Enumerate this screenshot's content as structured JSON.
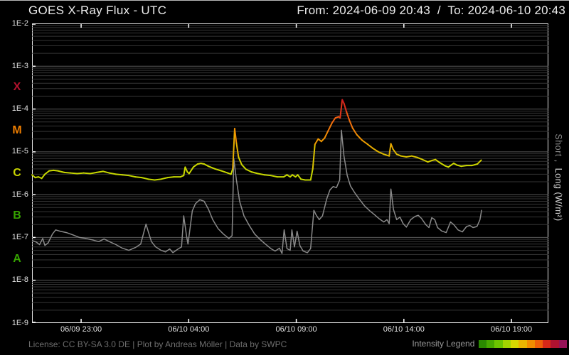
{
  "header": {
    "title": "GOES X-Ray Flux - UTC",
    "range": "From: 2024-06-09 20:43  /  To: 2024-06-10 20:43"
  },
  "footer": {
    "license": "License: CC BY-SA 3.0 DE | Plot by Andreas Möller | Data by SWPC",
    "legend_label": "Intensity Legend "
  },
  "right_axis_label": {
    "short": "Short",
    "separator": " ,  ",
    "long": "Long (W/m²)"
  },
  "chart_data": {
    "type": "line",
    "title": "GOES X-Ray Flux - UTC",
    "time_start": "2024-06-09 20:43",
    "time_end": "2024-06-10 20:43",
    "y_scale": "log",
    "y_range_labels": [
      "1E-9",
      "1E-2"
    ],
    "y_unit": "W/m²",
    "grid": true,
    "x_axis": {
      "ticks": [
        {
          "label": "06/09 23:00",
          "hours_from_start": 2.2833
        },
        {
          "label": "06/10 04:00",
          "hours_from_start": 7.2833
        },
        {
          "label": "06/10 09:00",
          "hours_from_start": 12.2833
        },
        {
          "label": "06/10 14:00",
          "hours_from_start": 17.2833
        },
        {
          "label": "06/10 19:00",
          "hours_from_start": 22.2833
        }
      ]
    },
    "y_axis": {
      "labels": [
        {
          "label": "1E-2",
          "exp": -2
        },
        {
          "label": "1E-3",
          "exp": -3
        },
        {
          "label": "1E-4",
          "exp": -4
        },
        {
          "label": "1E-5",
          "exp": -5
        },
        {
          "label": "1E-6",
          "exp": -6
        },
        {
          "label": "1E-7",
          "exp": -7
        },
        {
          "label": "1E-8",
          "exp": -8
        },
        {
          "label": "1E-9",
          "exp": -9
        }
      ]
    },
    "flare_classes": [
      {
        "label": "X",
        "mid_exp": -3.5,
        "color": "#b5122e"
      },
      {
        "label": "M",
        "mid_exp": -4.5,
        "color": "#ee7e00"
      },
      {
        "label": "C",
        "mid_exp": -5.5,
        "color": "#c9d500"
      },
      {
        "label": "B",
        "mid_exp": -6.5,
        "color": "#36a400"
      },
      {
        "label": "A",
        "mid_exp": -7.5,
        "color": "#36a400"
      }
    ],
    "legend_swatches": [
      "#2a8a00",
      "#46a800",
      "#6cc400",
      "#a2d400",
      "#d6d800",
      "#e9b400",
      "#f08c00",
      "#ee5e08",
      "#d82818",
      "#b01230",
      "#951257"
    ],
    "intensity_scale_stops": [
      {
        "logv": -7.0,
        "color": [
          74,
          158,
          0
        ]
      },
      {
        "logv": -6.3,
        "color": [
          140,
          200,
          0
        ]
      },
      {
        "logv": -5.9,
        "color": [
          188,
          212,
          0
        ]
      },
      {
        "logv": -5.3,
        "color": [
          204,
          216,
          0
        ]
      },
      {
        "logv": -5.0,
        "color": [
          226,
          182,
          0
        ]
      },
      {
        "logv": -4.75,
        "color": [
          238,
          152,
          0
        ]
      },
      {
        "logv": -4.45,
        "color": [
          242,
          125,
          10
        ]
      },
      {
        "logv": -4.15,
        "color": [
          236,
          85,
          16
        ]
      },
      {
        "logv": -3.9,
        "color": [
          216,
          31,
          32
        ]
      },
      {
        "logv": -3.6,
        "color": [
          181,
          18,
          46
        ]
      }
    ],
    "series": [
      {
        "name": "Long",
        "style": "intensity-colored",
        "width": 2,
        "points": [
          [
            0.0,
            2.9e-06
          ],
          [
            0.15,
            2.5e-06
          ],
          [
            0.3,
            2.6e-06
          ],
          [
            0.45,
            2.4e-06
          ],
          [
            0.6,
            3e-06
          ],
          [
            0.8,
            3.6e-06
          ],
          [
            1.0,
            3.7e-06
          ],
          [
            1.2,
            3.6e-06
          ],
          [
            1.5,
            3.3e-06
          ],
          [
            1.8,
            3.2e-06
          ],
          [
            2.1,
            3.1e-06
          ],
          [
            2.4,
            3.2e-06
          ],
          [
            2.7,
            3.1e-06
          ],
          [
            3.0,
            3.3e-06
          ],
          [
            3.3,
            3.5e-06
          ],
          [
            3.6,
            3.2e-06
          ],
          [
            3.9,
            3e-06
          ],
          [
            4.2,
            2.9e-06
          ],
          [
            4.5,
            2.8e-06
          ],
          [
            4.8,
            2.6e-06
          ],
          [
            5.1,
            2.5e-06
          ],
          [
            5.4,
            2.3e-06
          ],
          [
            5.7,
            2.2e-06
          ],
          [
            6.0,
            2.3e-06
          ],
          [
            6.3,
            2.5e-06
          ],
          [
            6.6,
            2.6e-06
          ],
          [
            6.9,
            2.6e-06
          ],
          [
            7.05,
            2.8e-06
          ],
          [
            7.12,
            4.4e-06
          ],
          [
            7.22,
            3.4e-06
          ],
          [
            7.3,
            3.1e-06
          ],
          [
            7.5,
            4.4e-06
          ],
          [
            7.7,
            5.2e-06
          ],
          [
            7.85,
            5.4e-06
          ],
          [
            8.0,
            5.2e-06
          ],
          [
            8.2,
            4.6e-06
          ],
          [
            8.5,
            4e-06
          ],
          [
            8.8,
            3.6e-06
          ],
          [
            9.1,
            3.2e-06
          ],
          [
            9.25,
            3e-06
          ],
          [
            9.33,
            4e-06
          ],
          [
            9.42,
            3.5e-05
          ],
          [
            9.5,
            1.6e-05
          ],
          [
            9.6,
            7.5e-06
          ],
          [
            9.75,
            5e-06
          ],
          [
            9.95,
            3.9e-06
          ],
          [
            10.2,
            3.4e-06
          ],
          [
            10.5,
            3.1e-06
          ],
          [
            10.8,
            2.9e-06
          ],
          [
            11.1,
            2.8e-06
          ],
          [
            11.4,
            2.6e-06
          ],
          [
            11.7,
            2.6e-06
          ],
          [
            11.85,
            2.9e-06
          ],
          [
            12.0,
            2.6e-06
          ],
          [
            12.1,
            2.9e-06
          ],
          [
            12.25,
            2.6e-06
          ],
          [
            12.35,
            2.9e-06
          ],
          [
            12.5,
            2.3e-06
          ],
          [
            12.7,
            2.2e-06
          ],
          [
            12.95,
            2.2e-06
          ],
          [
            13.05,
            4e-06
          ],
          [
            13.15,
            1.5e-05
          ],
          [
            13.3,
            2e-05
          ],
          [
            13.45,
            1.75e-05
          ],
          [
            13.6,
            2.1e-05
          ],
          [
            13.75,
            3e-05
          ],
          [
            13.95,
            4.8e-05
          ],
          [
            14.1,
            6.2e-05
          ],
          [
            14.25,
            6.6e-05
          ],
          [
            14.32,
            6.2e-05
          ],
          [
            14.42,
            0.000165
          ],
          [
            14.5,
            0.000135
          ],
          [
            14.62,
            8.5e-05
          ],
          [
            14.75,
            5.5e-05
          ],
          [
            14.9,
            3.6e-05
          ],
          [
            15.1,
            2.5e-05
          ],
          [
            15.35,
            1.85e-05
          ],
          [
            15.6,
            1.5e-05
          ],
          [
            15.85,
            1.2e-05
          ],
          [
            16.1,
            1e-05
          ],
          [
            16.35,
            8.8e-06
          ],
          [
            16.6,
            8e-06
          ],
          [
            16.68,
            1.55e-05
          ],
          [
            16.78,
            1.15e-05
          ],
          [
            16.95,
            8.8e-06
          ],
          [
            17.15,
            8e-06
          ],
          [
            17.4,
            7.6e-06
          ],
          [
            17.65,
            8e-06
          ],
          [
            17.9,
            7.4e-06
          ],
          [
            18.15,
            6.6e-06
          ],
          [
            18.4,
            5.8e-06
          ],
          [
            18.6,
            6.3e-06
          ],
          [
            18.75,
            6.6e-06
          ],
          [
            18.95,
            5.6e-06
          ],
          [
            19.2,
            4.7e-06
          ],
          [
            19.35,
            4.4e-06
          ],
          [
            19.6,
            5.4e-06
          ],
          [
            19.75,
            4.9e-06
          ],
          [
            19.95,
            4.6e-06
          ],
          [
            20.2,
            4.8e-06
          ],
          [
            20.45,
            4.8e-06
          ],
          [
            20.7,
            5.2e-06
          ],
          [
            20.88,
            6.4e-06
          ]
        ]
      },
      {
        "name": "Short",
        "style": "solid",
        "color": "#8a8a8a",
        "width": 1.5,
        "points": [
          [
            0.0,
            8.5e-08
          ],
          [
            0.2,
            7.8e-08
          ],
          [
            0.35,
            6.8e-08
          ],
          [
            0.5,
            9.5e-08
          ],
          [
            0.6,
            6.5e-08
          ],
          [
            0.75,
            7.5e-08
          ],
          [
            0.95,
            1.2e-07
          ],
          [
            1.1,
            1.5e-07
          ],
          [
            1.3,
            1.4e-07
          ],
          [
            1.6,
            1.3e-07
          ],
          [
            1.9,
            1.15e-07
          ],
          [
            2.2,
            1e-07
          ],
          [
            2.5,
            9.5e-08
          ],
          [
            2.8,
            8.8e-08
          ],
          [
            3.1,
            8e-08
          ],
          [
            3.35,
            9.2e-08
          ],
          [
            3.6,
            8e-08
          ],
          [
            3.9,
            6.8e-08
          ],
          [
            4.2,
            5.6e-08
          ],
          [
            4.5,
            5e-08
          ],
          [
            4.8,
            5.8e-08
          ],
          [
            5.05,
            7e-08
          ],
          [
            5.3,
            2.05e-07
          ],
          [
            5.4,
            1.4e-07
          ],
          [
            5.55,
            8e-08
          ],
          [
            5.75,
            6e-08
          ],
          [
            6.0,
            5e-08
          ],
          [
            6.2,
            4.6e-08
          ],
          [
            6.4,
            5.4e-08
          ],
          [
            6.55,
            4.4e-08
          ],
          [
            6.75,
            5.2e-08
          ],
          [
            6.95,
            6e-08
          ],
          [
            7.05,
            3.2e-07
          ],
          [
            7.18,
            1.1e-07
          ],
          [
            7.25,
            7e-08
          ],
          [
            7.45,
            4.2e-07
          ],
          [
            7.6,
            6.2e-07
          ],
          [
            7.8,
            7.6e-07
          ],
          [
            8.0,
            7e-07
          ],
          [
            8.2,
            4.6e-07
          ],
          [
            8.4,
            2.6e-07
          ],
          [
            8.65,
            1.6e-07
          ],
          [
            8.9,
            1.2e-07
          ],
          [
            9.15,
            9.5e-08
          ],
          [
            9.3,
            1.1e-07
          ],
          [
            9.38,
            7e-06
          ],
          [
            9.5,
            2.2e-06
          ],
          [
            9.65,
            7e-07
          ],
          [
            9.85,
            3.2e-07
          ],
          [
            10.1,
            1.9e-07
          ],
          [
            10.35,
            1.2e-07
          ],
          [
            10.6,
            9e-08
          ],
          [
            10.85,
            7e-08
          ],
          [
            11.1,
            5.5e-08
          ],
          [
            11.3,
            4.8e-08
          ],
          [
            11.5,
            5.6e-08
          ],
          [
            11.62,
            4.2e-08
          ],
          [
            11.72,
            1.5e-07
          ],
          [
            11.85,
            5.5e-08
          ],
          [
            12.0,
            5e-08
          ],
          [
            12.08,
            1.5e-07
          ],
          [
            12.2,
            6e-08
          ],
          [
            12.32,
            1.4e-07
          ],
          [
            12.45,
            6.5e-08
          ],
          [
            12.6,
            4.8e-08
          ],
          [
            12.8,
            4.4e-08
          ],
          [
            12.95,
            5.5e-08
          ],
          [
            13.1,
            4.3e-07
          ],
          [
            13.2,
            3.4e-07
          ],
          [
            13.35,
            2.6e-07
          ],
          [
            13.5,
            3.2e-07
          ],
          [
            13.7,
            8e-07
          ],
          [
            13.85,
            1.3e-06
          ],
          [
            14.0,
            1.55e-06
          ],
          [
            14.15,
            1.45e-06
          ],
          [
            14.3,
            2.2e-06
          ],
          [
            14.38,
            3.2e-05
          ],
          [
            14.5,
            8e-06
          ],
          [
            14.65,
            2.8e-06
          ],
          [
            14.8,
            1.6e-06
          ],
          [
            15.0,
            1.1e-06
          ],
          [
            15.2,
            8e-07
          ],
          [
            15.45,
            5.5e-07
          ],
          [
            15.7,
            4.2e-07
          ],
          [
            15.95,
            3.3e-07
          ],
          [
            16.15,
            2.7e-07
          ],
          [
            16.35,
            2.3e-07
          ],
          [
            16.5,
            2.6e-07
          ],
          [
            16.6,
            2.1e-07
          ],
          [
            16.68,
            1.35e-06
          ],
          [
            16.8,
            4.5e-07
          ],
          [
            16.95,
            2.6e-07
          ],
          [
            17.1,
            3e-07
          ],
          [
            17.25,
            2.1e-07
          ],
          [
            17.4,
            1.75e-07
          ],
          [
            17.6,
            2.6e-07
          ],
          [
            17.8,
            3.1e-07
          ],
          [
            17.95,
            3.3e-07
          ],
          [
            18.1,
            2.8e-07
          ],
          [
            18.3,
            2e-07
          ],
          [
            18.45,
            1.7e-07
          ],
          [
            18.58,
            2.9e-07
          ],
          [
            18.72,
            2.6e-07
          ],
          [
            18.85,
            1.7e-07
          ],
          [
            19.05,
            1.4e-07
          ],
          [
            19.25,
            1.3e-07
          ],
          [
            19.45,
            2.3e-07
          ],
          [
            19.6,
            2e-07
          ],
          [
            19.8,
            1.5e-07
          ],
          [
            20.0,
            1.35e-07
          ],
          [
            20.2,
            1.8e-07
          ],
          [
            20.35,
            1.9e-07
          ],
          [
            20.5,
            1.7e-07
          ],
          [
            20.68,
            1.8e-07
          ],
          [
            20.82,
            2.6e-07
          ],
          [
            20.9,
            4.4e-07
          ]
        ]
      }
    ]
  }
}
